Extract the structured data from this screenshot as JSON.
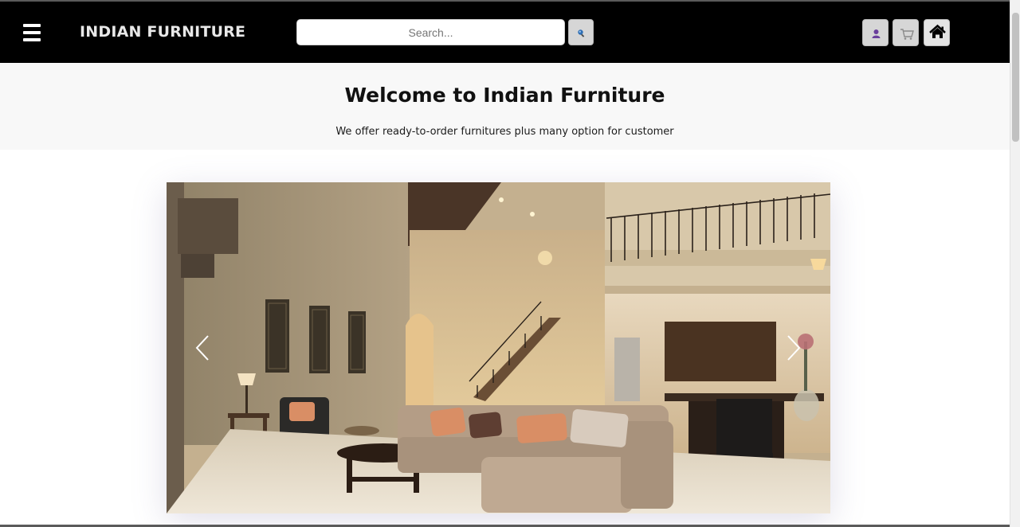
{
  "navbar": {
    "brand": "INDIAN FURNITURE",
    "search": {
      "placeholder": "Search...",
      "value": ""
    },
    "icons": {
      "menu": "hamburger-menu-icon",
      "search": "magnifier-icon",
      "user": "user-icon",
      "cart": "shopping-cart-icon",
      "home": "home-icon"
    }
  },
  "hero": {
    "title": "Welcome to Indian Furniture",
    "subtitle": "We offer ready-to-order furnitures plus many option for customer"
  },
  "carousel": {
    "image": "living-room-interior",
    "prev_icon": "chevron-left-icon",
    "next_icon": "chevron-right-icon"
  },
  "colors": {
    "navbar_bg": "#000000",
    "hero_bg": "#f8f8f8",
    "button_bg": "#d6d6d6"
  }
}
